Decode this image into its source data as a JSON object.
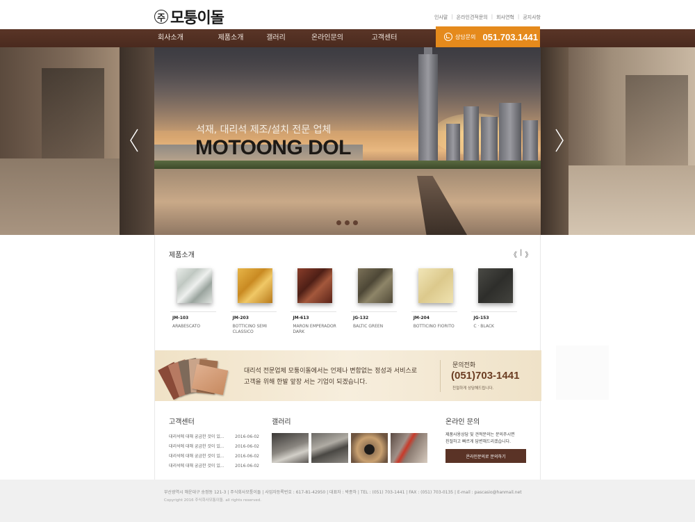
{
  "header": {
    "logo_mark": "주",
    "logo_text": "모퉁이돌",
    "util_links": [
      "인사말",
      "온라인견적문의",
      "회사연혁",
      "공지사항"
    ]
  },
  "nav": {
    "items": [
      "회사소개",
      "제품소개",
      "갤러리",
      "온라인문의",
      "고객센터"
    ],
    "cta_label": "상담문의",
    "cta_phone": "051.703.1441",
    "cta_color": "#e58a1c",
    "bar_color": "#4a2a1e"
  },
  "hero": {
    "subtitle": "석재, 대리석 제조/설치 전문 업체",
    "title": "MOTOONG DOL",
    "slide_count": 3,
    "prev_icon": "chevron-left-icon",
    "next_icon": "chevron-right-icon"
  },
  "products": {
    "title": "제품소개",
    "pager_prev": "《",
    "pager_sep": "|",
    "pager_next": "》",
    "items": [
      {
        "code": "JM-103",
        "name": "ARABESCATO",
        "color": "#c9cec9"
      },
      {
        "code": "JM-203",
        "name": "BOTTICINO SEMI CLASSICO",
        "color": "#d9a03a"
      },
      {
        "code": "JM-613",
        "name": "MARON EMPERADOR DARK",
        "color": "#6e2f22"
      },
      {
        "code": "JG-132",
        "name": "BALTIC GREEN",
        "color": "#6b6148"
      },
      {
        "code": "JM-204",
        "name": "BOTTICINO FIORITO",
        "color": "#e8d9a4"
      },
      {
        "code": "JG-153",
        "name": "C · BLACK",
        "color": "#3c3c38"
      }
    ]
  },
  "banner": {
    "line1": "대리석 전문업체 모퉁이돌에서는 언제나 변함없는 정성과 서비스로",
    "line2": "고객을 위해 한발 앞장 서는 기업이 되겠습니다.",
    "phone_label": "문의전화",
    "phone": "(051)703-1441",
    "phone_note": "친절하게 상담해드립니다."
  },
  "customer_center": {
    "title": "고객센터",
    "rows": [
      {
        "text": "대리석에 대해 궁금한 것이 있...",
        "date": "2016-06-02"
      },
      {
        "text": "대리석에 대해 궁금한 것이 있...",
        "date": "2016-06-02"
      },
      {
        "text": "대리석에 대해 궁금한 것이 있...",
        "date": "2016-06-02"
      },
      {
        "text": "대리석에 대해 궁금한 것이 있...",
        "date": "2016-06-02"
      }
    ]
  },
  "gallery": {
    "title": "갤러리"
  },
  "inquiry": {
    "title": "온라인 문의",
    "line1": "제품사용상담 및 견적문의는 문의주시면",
    "line2": "친절하고 빠르게 답변해드리겠습니다.",
    "button": "온라인문의로 문의하기"
  },
  "footer": {
    "line1": "부산광역시 해운대구 송정동 121-3  |  주식회사모퉁이돌  |  사업자등록번호 : 617-81-42950  |  대표자 : 박종하  |  TEL : (051) 703-1441  |  FAX : (051) 703-0135  |  E-mail : pascasio@hanmail.net",
    "line2": "Copyright 2016 주식회사모퉁이돌. all rights reserved."
  }
}
